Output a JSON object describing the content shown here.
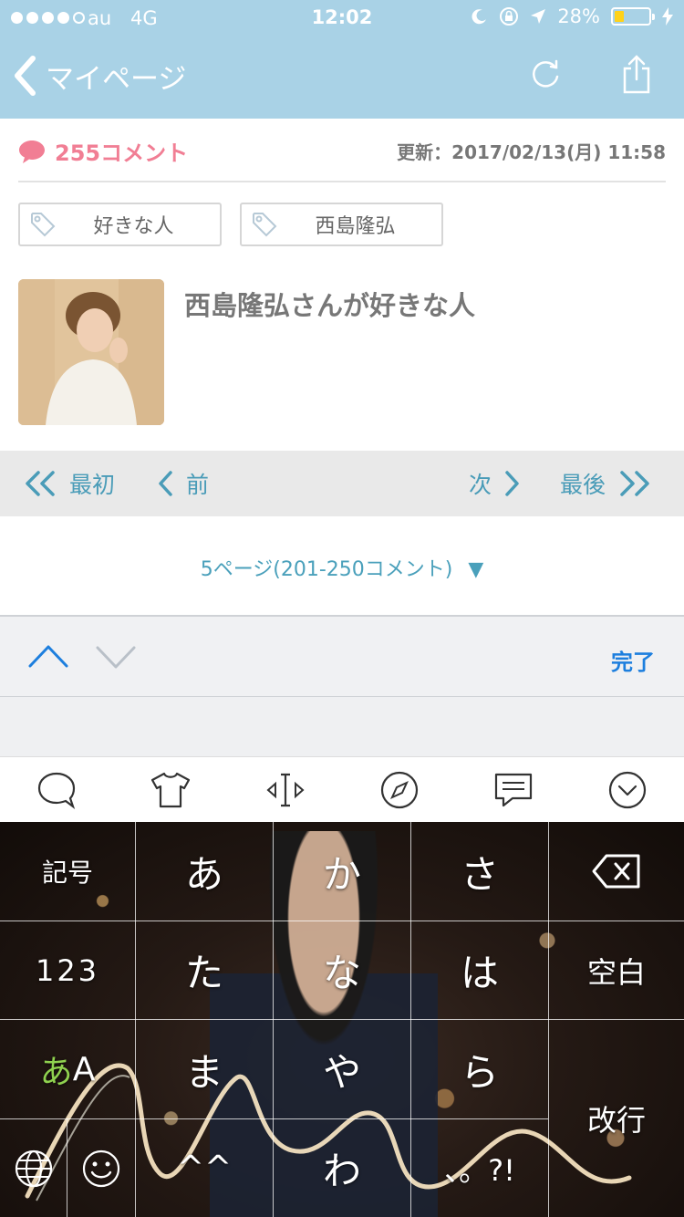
{
  "status": {
    "carrier": "au",
    "network": "4G",
    "time": "12:02",
    "battery_percent": "28%",
    "battery_level": 0.28
  },
  "nav": {
    "back_label": "マイページ",
    "icons": [
      "chevron-left-icon",
      "reload-icon",
      "share-icon"
    ]
  },
  "meta": {
    "comment_count": "255コメント",
    "updated": "更新：2017/02/13(月) 11:58"
  },
  "tags": [
    {
      "label": "好きな人"
    },
    {
      "label": "西島隆弘"
    }
  ],
  "topic": {
    "title": "西島隆弘さんが好きな人"
  },
  "pager": {
    "first": "最初",
    "prev": "前",
    "next": "次",
    "last": "最後"
  },
  "page_select": {
    "label": "5ページ(201-250コメント)",
    "arrow": "▼"
  },
  "keyboard_toolbar": {
    "done": "完了"
  },
  "keyboard_icons": [
    "chat-bubble-icon",
    "tshirt-icon",
    "cursor-move-icon",
    "compass-icon",
    "message-icon",
    "collapse-icon"
  ],
  "keyboard": {
    "row1": [
      "記号",
      "あ",
      "か",
      "さ"
    ],
    "row2": [
      "123",
      "た",
      "な",
      "は",
      "空白"
    ],
    "row3": [
      "あ",
      "A",
      "ま",
      "や",
      "ら"
    ],
    "row4": [
      "^^",
      "わ",
      "、。?!"
    ],
    "return": "改行",
    "colors": {
      "accent_green": "#8fd14f"
    }
  },
  "colors": {
    "header": "#a9d2e6",
    "accent_pink": "#f17e94",
    "link_blue": "#4a9cb8",
    "done_blue": "#1d7fde"
  }
}
